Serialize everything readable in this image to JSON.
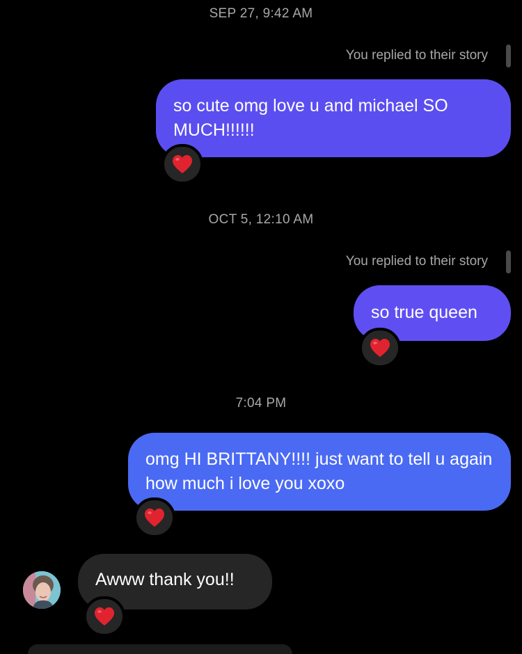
{
  "colors": {
    "background": "#000000",
    "bubble_out_1": "#5b4ef0",
    "bubble_out_2": "#5f4ff2",
    "bubble_out_3": "#4a6af4",
    "bubble_in": "#262626",
    "meta_text": "#a8a8a8",
    "reaction_heart": "#e0242f"
  },
  "messages": [
    {
      "timestamp": "SEP 27, 9:42 AM",
      "reply_note": "You replied to their story",
      "text": "so cute omg love u and michael SO MUCH!!!!!!",
      "reaction": "heart-icon"
    },
    {
      "timestamp": "OCT 5, 12:10 AM",
      "reply_note": "You replied to their story",
      "text": "so true queen",
      "reaction": "heart-icon"
    },
    {
      "timestamp": "7:04 PM",
      "text": "omg HI BRITTANY!!!! just want to tell u again how much i love you xoxo",
      "reaction": "heart-icon"
    },
    {
      "text": "Awww thank you!!",
      "reaction": "heart-icon",
      "sender_avatar": "avatar-icon"
    }
  ]
}
